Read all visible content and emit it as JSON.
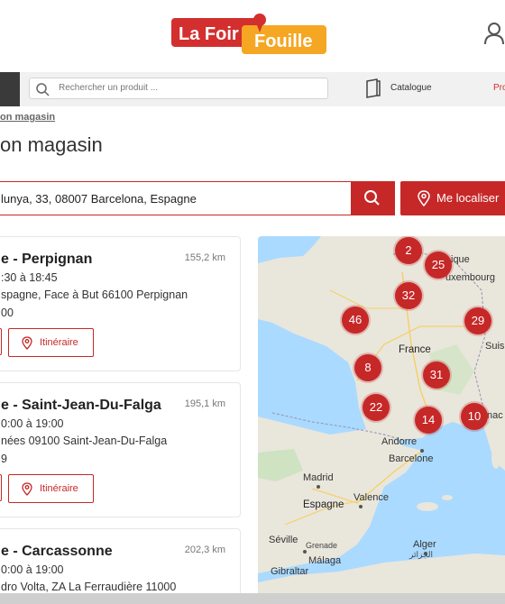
{
  "header": {
    "logo_text_1": "La Foir",
    "logo_text_2": "Fouille"
  },
  "nav": {
    "search_placeholder": "Rechercher un produit ...",
    "catalogue_label": "Catalogue",
    "promo_label": "Pro"
  },
  "breadcrumb": "on magasin",
  "page_title": "on magasin",
  "address_search": {
    "value": "lunya, 33, 08007 Barcelona, Espagne",
    "locate_label": "Me localiser"
  },
  "stores": [
    {
      "name": "e - Perpignan",
      "distance": "155,2 km",
      "hours": ":30 à 18:45",
      "address": "spagne, Face à But 66100 Perpignan",
      "phone": "00",
      "itinerary_label": "Itinéraire"
    },
    {
      "name": "e - Saint-Jean-Du-Falga",
      "distance": "195,1 km",
      "hours": "0:00 à 19:00",
      "address": "nées 09100 Saint-Jean-Du-Falga",
      "phone": "9",
      "itinerary_label": "Itinéraire"
    },
    {
      "name": "e - Carcassonne",
      "distance": "202,3 km",
      "hours": "0:00 à 19:00",
      "address": "dro Volta, ZA La Ferraudière 11000"
    }
  ],
  "map": {
    "clusters": [
      "2",
      "25",
      "32",
      "46",
      "29",
      "8",
      "31",
      "22",
      "14",
      "10"
    ],
    "labels": {
      "belgique": "ique",
      "luxembourg": "uxembourg",
      "france": "France",
      "suisse": "Suis",
      "monaco": "nac",
      "andorre": "Andorre",
      "barcelone": "Barcelone",
      "madrid": "Madrid",
      "valence": "Valence",
      "espagne": "Espagne",
      "seville": "Séville",
      "grenade": "Grenade",
      "malaga": "Málaga",
      "alger": "Alger",
      "alger_ar": "الجزائر",
      "gibraltar": "Gibraltar"
    },
    "colors": {
      "land": "#e9e6dc",
      "sea": "#aadaff",
      "cluster": "#c62828"
    }
  },
  "colors": {
    "brand_red": "#c62828",
    "logo_orange": "#f5a623"
  }
}
